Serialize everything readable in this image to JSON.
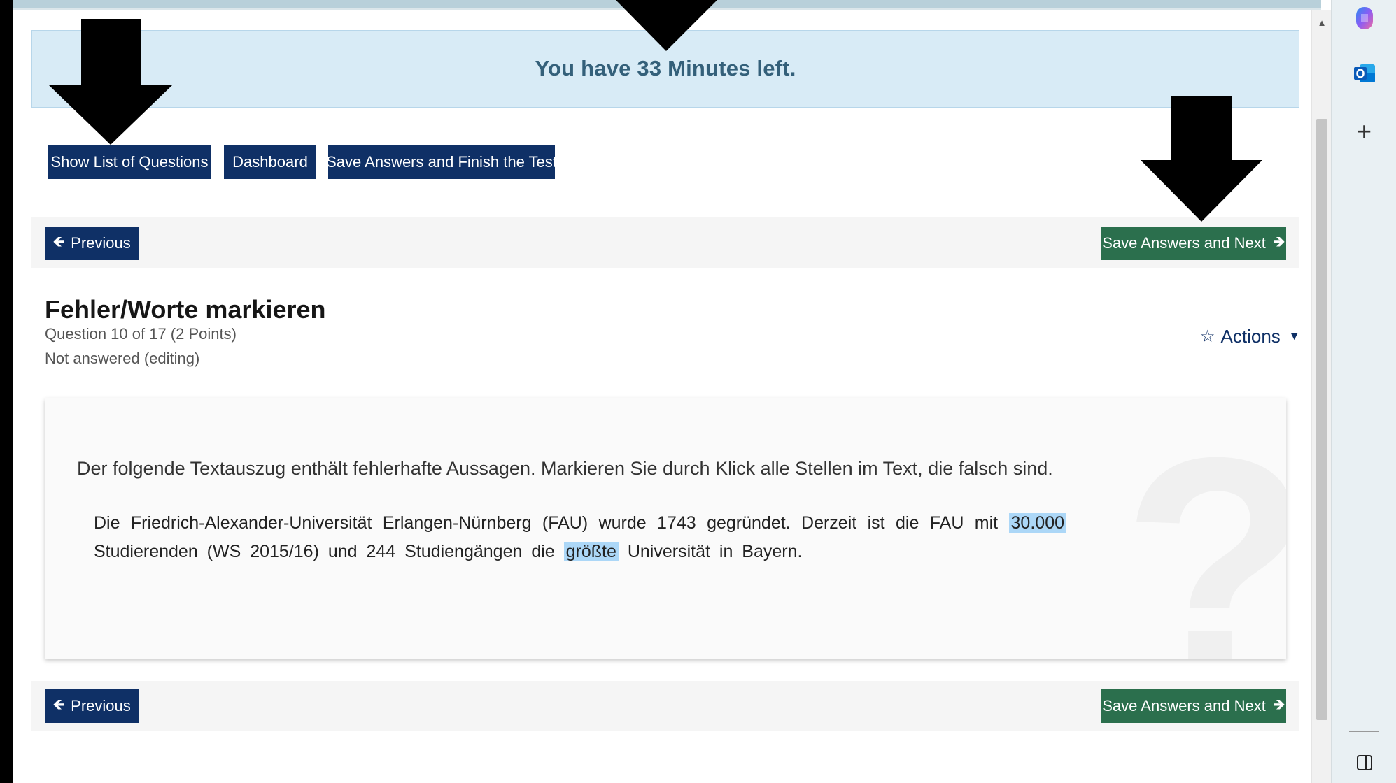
{
  "timer": {
    "text": "You have 33 Minutes left."
  },
  "toolbar": {
    "show_list_label": "Show List of Questions",
    "dashboard_label": "Dashboard",
    "finish_label": "Save Answers and Finish the Test"
  },
  "nav": {
    "previous_label": "Previous",
    "next_label": "Save Answers and Next"
  },
  "question": {
    "title": "Fehler/Worte markieren",
    "info": "Question 10 of 17 (2 Points)",
    "status": "Not answered (editing)",
    "actions_label": "Actions",
    "instructions": "Der folgende Textauszug enthält fehlerhafte Aussagen. Markieren Sie durch Klick alle Stellen im Text, die falsch sind.",
    "passage": {
      "part1": "Die Friedrich-Alexander-Universität Erlangen-Nürnberg (FAU) wurde 1743 gegründet. Derzeit ist die FAU mit ",
      "marked1": "30.000",
      "part2": " Studierenden (WS 2015/16) und 244 Studiengängen die ",
      "marked2": "größte",
      "part3": " Universität in Bayern."
    }
  },
  "icons": {
    "previous": "arrow-left-icon",
    "next": "arrow-right-icon",
    "actions": "star-outline-icon",
    "caret": "caret-down-icon",
    "sidebar": [
      "copilot-icon",
      "outlook-icon",
      "plus-icon",
      "side-panel-icon"
    ]
  },
  "colors": {
    "primary_button": "#0f3066",
    "next_button": "#2b6f4d",
    "banner_bg": "#d8ebf6",
    "banner_text": "#34607a",
    "highlight": "#acd7f7"
  }
}
